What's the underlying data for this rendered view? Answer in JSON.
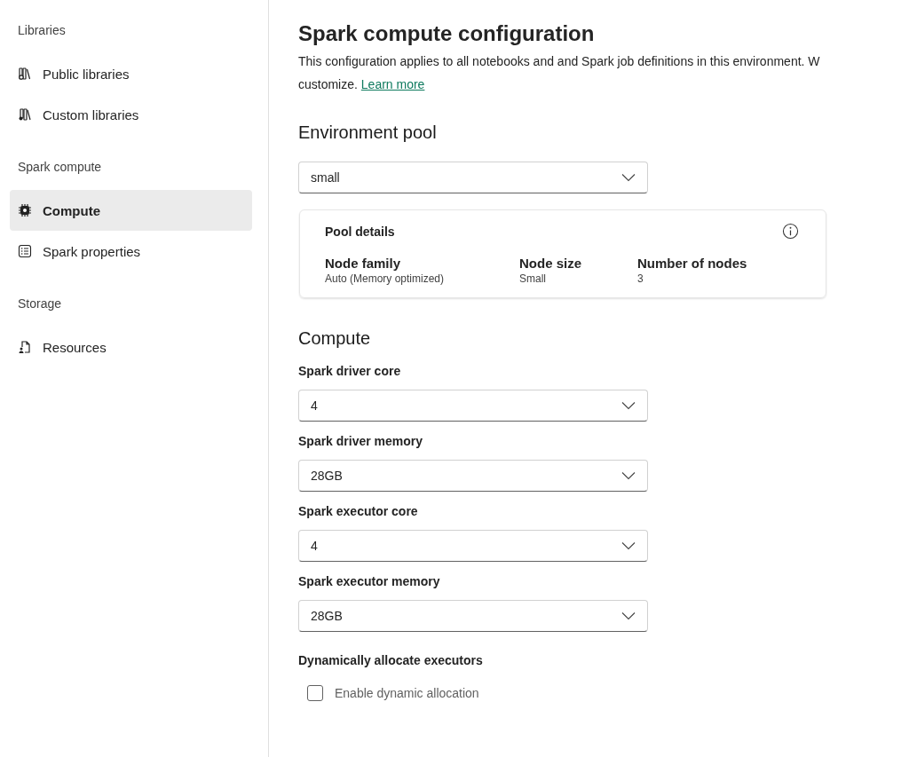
{
  "sidebar": {
    "sections": [
      {
        "heading": "Libraries",
        "items": [
          {
            "label": "Public libraries",
            "selected": false
          },
          {
            "label": "Custom libraries",
            "selected": false
          }
        ]
      },
      {
        "heading": "Spark compute",
        "items": [
          {
            "label": "Compute",
            "selected": true
          },
          {
            "label": "Spark properties",
            "selected": false
          }
        ]
      },
      {
        "heading": "Storage",
        "items": [
          {
            "label": "Resources",
            "selected": false
          }
        ]
      }
    ]
  },
  "main": {
    "title": "Spark compute configuration",
    "description": {
      "line_1": "This configuration applies to all notebooks and and Spark job definitions in this environment. W",
      "line_2": "customize.",
      "link": "Learn more"
    },
    "environment_pool": {
      "heading": "Environment pool",
      "value": "small",
      "pool_details": {
        "title": "Pool details",
        "columns": [
          {
            "label": "Node family",
            "value": "Auto (Memory optimized)"
          },
          {
            "label": "Node size",
            "value": "Small"
          },
          {
            "label": "Number of nodes",
            "value": "3"
          }
        ]
      }
    },
    "compute": {
      "heading": "Compute",
      "fields": [
        {
          "label": "Spark driver core",
          "value": "4"
        },
        {
          "label": "Spark driver memory",
          "value": "28GB"
        },
        {
          "label": "Spark executor core",
          "value": "4"
        },
        {
          "label": "Spark executor memory",
          "value": "28GB"
        }
      ],
      "dynamic": {
        "heading": "Dynamically allocate executors",
        "checkbox": {
          "label": "Enable dynamic allocation",
          "checked": false
        }
      }
    }
  }
}
